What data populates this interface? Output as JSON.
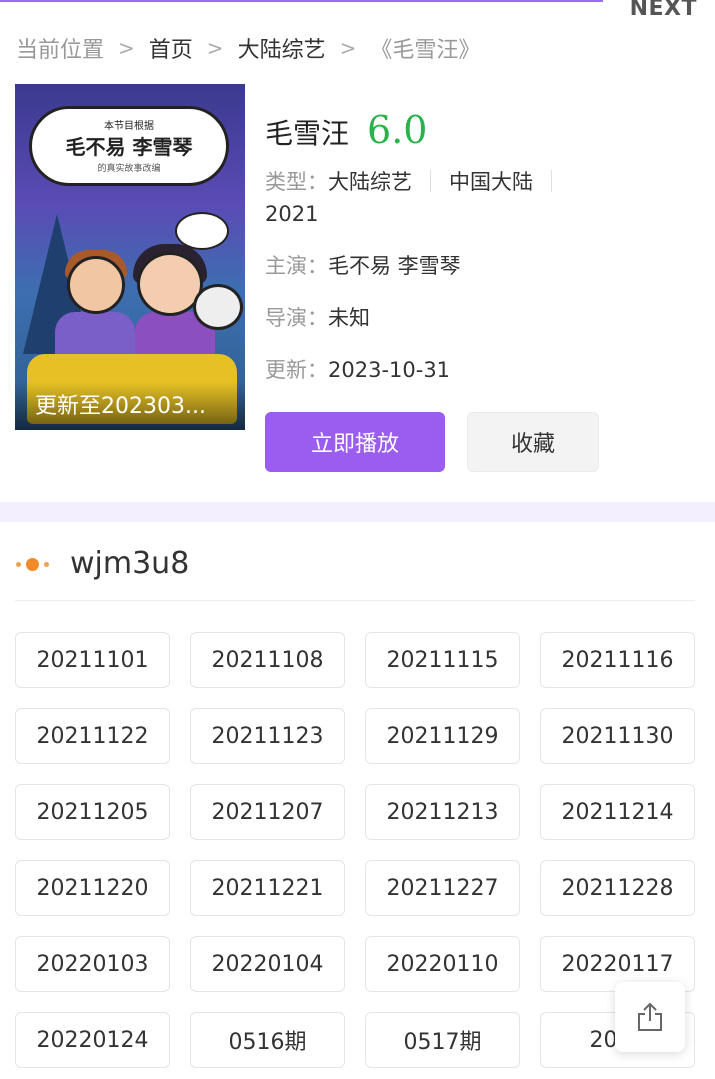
{
  "topbar": {
    "next_label": "NEXT"
  },
  "breadcrumb": {
    "prefix": "当前位置",
    "home": "首页",
    "category": "大陆综艺",
    "current": "《毛雪汪》"
  },
  "poster": {
    "cloud_top": "本节目根据",
    "cloud_names": "毛不易 李雪琴",
    "cloud_sub": "的真实故事改编",
    "update_text": "更新至202303..."
  },
  "show": {
    "title": "毛雪汪",
    "score": "6.0",
    "type_label": "类型：",
    "type_value": "大陆综艺",
    "region": "中国大陆",
    "year": "2021",
    "stars_label": "主演：",
    "stars_value": "毛不易 李雪琴",
    "director_label": "导演：",
    "director_value": "未知",
    "updated_label": "更新：",
    "updated_value": "2023-10-31"
  },
  "actions": {
    "play_label": "立即播放",
    "favorite_label": "收藏"
  },
  "section": {
    "title": "wjm3u8"
  },
  "episodes": [
    "20211101",
    "20211108",
    "20211115",
    "20211116",
    "20211122",
    "20211123",
    "20211129",
    "20211130",
    "20211205",
    "20211207",
    "20211213",
    "20211214",
    "20211220",
    "20211221",
    "20211227",
    "20211228",
    "20220103",
    "20220104",
    "20220110",
    "20220117",
    "20220124",
    "0516期",
    "0517期",
    "2022"
  ],
  "colors": {
    "accent": "#9b5cf0",
    "score": "#2bb24c",
    "band": "#f3efff"
  },
  "icons": {
    "share": "share-icon",
    "section": "dots-icon"
  }
}
